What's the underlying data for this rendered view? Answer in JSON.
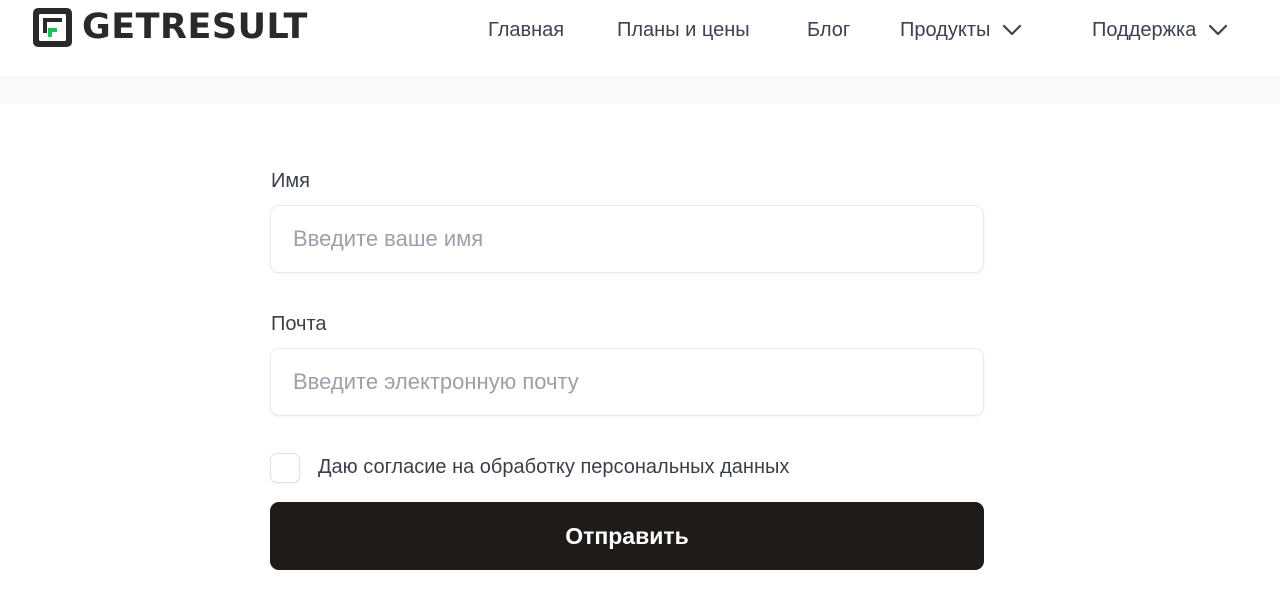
{
  "colors": {
    "brand_green": "#1fbf5a",
    "logo_dark": "#2a2a2a",
    "button_bg": "#1e1b19",
    "button_text": "#ffffff",
    "placeholder": "#9aa1ab",
    "header_strip": "#f8f9fb"
  },
  "header": {
    "logo": {
      "icon": "getresult-logo-icon",
      "text": "GETRESULT"
    },
    "nav": [
      {
        "label": "Главная",
        "has_dropdown": false
      },
      {
        "label": "Планы и цены",
        "has_dropdown": false
      },
      {
        "label": "Блог",
        "has_dropdown": false
      },
      {
        "label": "Продукты",
        "has_dropdown": true,
        "icon": "chevron-down-icon"
      },
      {
        "label": "Поддержка",
        "has_dropdown": true,
        "icon": "chevron-down-icon"
      }
    ]
  },
  "form": {
    "name": {
      "label": "Имя",
      "placeholder": "Введите ваше имя",
      "value": ""
    },
    "email": {
      "label": "Почта",
      "placeholder": "Введите электронную почту",
      "value": ""
    },
    "consent": {
      "label": "Даю согласие на обработку персональных данных",
      "checked": false
    },
    "submit_label": "Отправить"
  }
}
